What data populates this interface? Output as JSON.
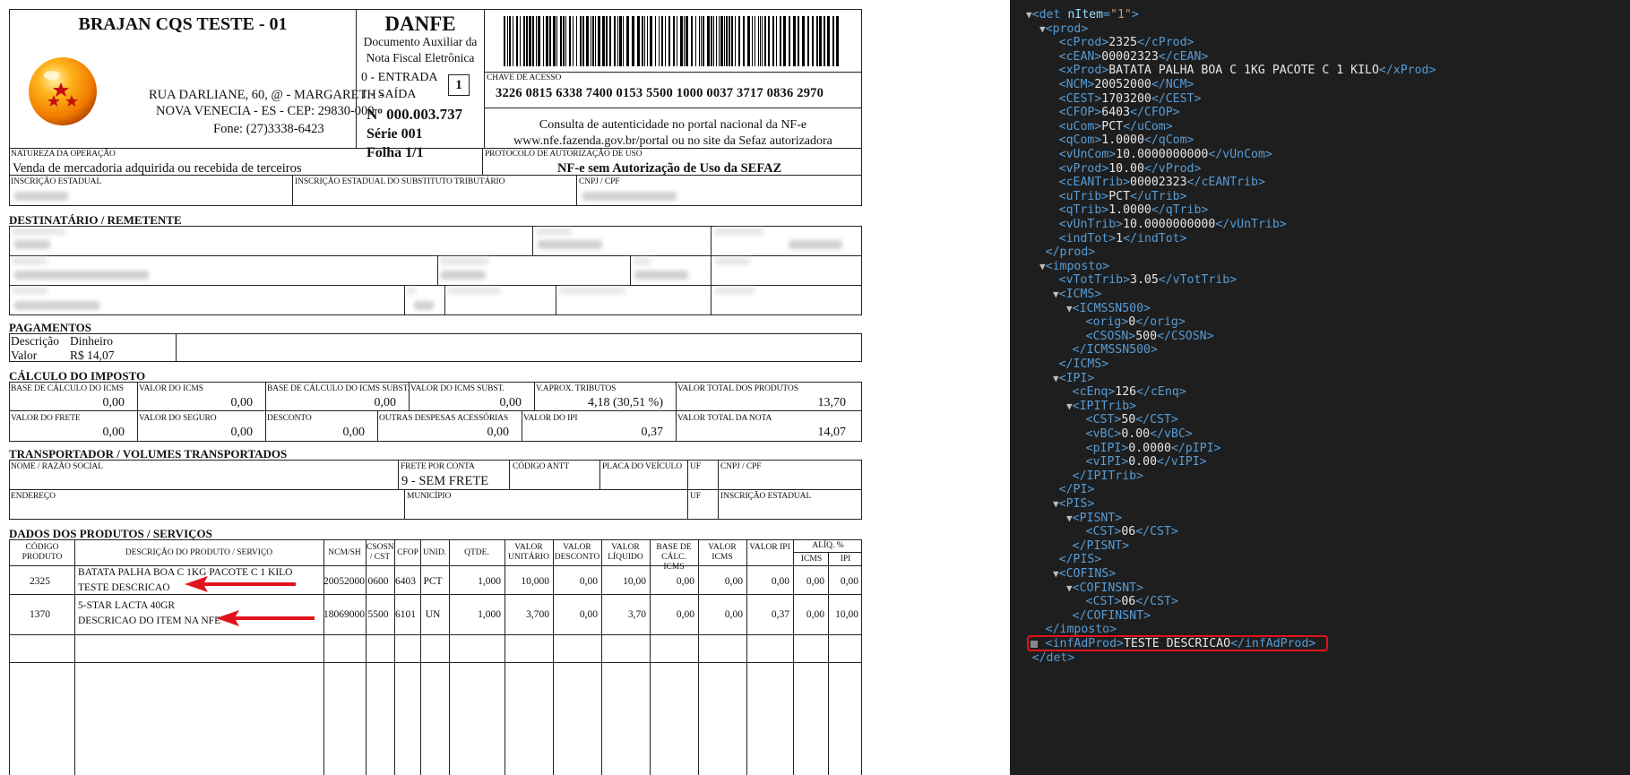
{
  "emitente": {
    "nome": "BRAJAN CQS TESTE - 01",
    "endereco1": "RUA DARLIANE, 60, @ - MARGARETH -",
    "endereco2": "NOVA VENECIA - ES - CEP: 29830-000",
    "fone": "Fone: (27)3338-6423",
    "logo": "dragon-ball-logo"
  },
  "danfe": {
    "title": "DANFE",
    "sub1": "Documento Auxiliar da",
    "sub2": "Nota Fiscal Eletrônica",
    "entrada": "0 - ENTRADA",
    "saida": "1 - SAÍDA",
    "tipo": "1",
    "numero": "Nº 000.003.737",
    "serie": "Série 001",
    "folha": "Folha 1/1"
  },
  "chave": {
    "label": "CHAVE DE ACESSO",
    "value": "3226 0815 6338 7400 0153 5500 1000 0037 3717 0836 2970",
    "consulta1": "Consulta de autenticidade no portal nacional da NF-e",
    "consulta2": "www.nfe.fazenda.gov.br/portal ou no site da Sefaz autorizadora"
  },
  "natureza": {
    "label": "NATUREZA DA OPERAÇÃO",
    "value": "Venda de mercadoria adquirida ou recebida de terceiros",
    "protocolo_label": "PROTOCOLO DE AUTORIZAÇÃO DE USO",
    "protocolo_value": "NF-e sem Autorização de Uso da SEFAZ"
  },
  "inscricao": {
    "ie_label": "INSCRIÇÃO ESTADUAL",
    "ie_st_label": "INSCRIÇÃO ESTADUAL DO SUBSTITUTO TRIBUTÁRIO",
    "cnpj_label": "CNPJ / CPF"
  },
  "destinatario": {
    "title": "DESTINATÁRIO / REMETENTE"
  },
  "pagamentos": {
    "title": "PAGAMENTOS",
    "descricao_label": "Descrição",
    "descricao_value": "Dinheiro",
    "valor_label": "Valor",
    "valor_value": "R$ 14,07"
  },
  "calculo": {
    "title": "CÁLCULO DO IMPOSTO",
    "row1": [
      {
        "label": "BASE DE CÁLCULO DO ICMS",
        "value": "0,00"
      },
      {
        "label": "VALOR DO ICMS",
        "value": "0,00"
      },
      {
        "label": "BASE DE CÁLCULO DO ICMS SUBST.",
        "value": "0,00"
      },
      {
        "label": "VALOR DO ICMS SUBST.",
        "value": "0,00"
      },
      {
        "label": "V.APROX. TRIBUTOS",
        "value": "4,18 (30,51 %)"
      },
      {
        "label": "VALOR TOTAL DOS PRODUTOS",
        "value": "13,70"
      }
    ],
    "row2": [
      {
        "label": "VALOR DO FRETE",
        "value": "0,00"
      },
      {
        "label": "VALOR DO SEGURO",
        "value": "0,00"
      },
      {
        "label": "DESCONTO",
        "value": "0,00"
      },
      {
        "label": "OUTRAS DESPESAS ACESSÓRIAS",
        "value": "0,00"
      },
      {
        "label": "VALOR DO IPI",
        "value": "0,37"
      },
      {
        "label": "VALOR TOTAL DA NOTA",
        "value": "14,07"
      }
    ]
  },
  "transportador": {
    "title": "TRANSPORTADOR / VOLUMES TRANSPORTADOS",
    "nome_label": "NOME / RAZÃO SOCIAL",
    "frete_label": "FRETE POR CONTA",
    "frete_value": "9 - SEM FRETE",
    "antt_label": "CÓDIGO ANTT",
    "placa_label": "PLACA DO VEÍCULO",
    "uf_label": "UF",
    "cnpj_label": "CNPJ / CPF",
    "endereco_label": "ENDEREÇO",
    "municipio_label": "MUNICÍPIO",
    "uf2_label": "UF",
    "ie_label": "INSCRIÇÃO ESTADUAL"
  },
  "produtos": {
    "title": "DADOS DOS PRODUTOS / SERVIÇOS",
    "headers": {
      "codigo": "CÓDIGO PRODUTO",
      "descricao": "DESCRIÇÃO DO PRODUTO / SERVIÇO",
      "ncm": "NCM/SH",
      "csosn": "CSOSN / CST",
      "cfop": "CFOP",
      "unid": "UNID.",
      "qtde": "QTDE.",
      "vunit": "VALOR UNITÁRIO",
      "vdesc": "VALOR DESCONTO",
      "vliq": "VALOR LÍQUIDO",
      "bcicms": "BASE DE CÁLC. ICMS",
      "vicms": "VALOR ICMS",
      "vipi": "VALOR IPI",
      "aliq": "ALÍQ. %",
      "aicms": "ICMS",
      "aipi": "IPI"
    },
    "rows": [
      {
        "codigo": "2325",
        "desc1": "BATATA PALHA BOA C 1KG PACOTE C 1 KILO",
        "desc2": "TESTE DESCRICAO",
        "ncm": "20052000",
        "csosn": "0600",
        "cfop": "6403",
        "unid": "PCT",
        "qtde": "1,000",
        "vunit": "10,000",
        "vdesc": "0,00",
        "vliq": "10,00",
        "bcicms": "0,00",
        "vicms": "0,00",
        "vipi": "0,00",
        "aicms": "0,00",
        "aipi": "0,00"
      },
      {
        "codigo": "1370",
        "desc1": "5-STAR LACTA 40GR",
        "desc2": "DESCRICAO DO ITEM NA NFE",
        "ncm": "18069000",
        "csosn": "5500",
        "cfop": "6101",
        "unid": "UN",
        "qtde": "1,000",
        "vunit": "3,700",
        "vdesc": "0,00",
        "vliq": "3,70",
        "bcicms": "0,00",
        "vicms": "0,00",
        "vipi": "0,37",
        "aicms": "0,00",
        "aipi": "10,00"
      }
    ]
  },
  "xml": {
    "lines": [
      {
        "indent": 0,
        "tri": true,
        "open": "det",
        "attr": "nItem",
        "attrval": "\"1\"",
        "kind": "open"
      },
      {
        "indent": 1,
        "tri": true,
        "open": "prod",
        "kind": "open"
      },
      {
        "indent": 2,
        "tag": "cProd",
        "text": "2325",
        "kind": "leaf"
      },
      {
        "indent": 2,
        "tag": "cEAN",
        "text": "00002323",
        "kind": "leaf"
      },
      {
        "indent": 2,
        "tag": "xProd",
        "text": "BATATA PALHA BOA C 1KG PACOTE C 1 KILO",
        "kind": "leaf"
      },
      {
        "indent": 2,
        "tag": "NCM",
        "text": "20052000",
        "kind": "leaf"
      },
      {
        "indent": 2,
        "tag": "CEST",
        "text": "1703200",
        "kind": "leaf"
      },
      {
        "indent": 2,
        "tag": "CFOP",
        "text": "6403",
        "kind": "leaf"
      },
      {
        "indent": 2,
        "tag": "uCom",
        "text": "PCT",
        "kind": "leaf"
      },
      {
        "indent": 2,
        "tag": "qCom",
        "text": "1.0000",
        "kind": "leaf"
      },
      {
        "indent": 2,
        "tag": "vUnCom",
        "text": "10.0000000000",
        "kind": "leaf"
      },
      {
        "indent": 2,
        "tag": "vProd",
        "text": "10.00",
        "kind": "leaf"
      },
      {
        "indent": 2,
        "tag": "cEANTrib",
        "text": "00002323",
        "kind": "leaf"
      },
      {
        "indent": 2,
        "tag": "uTrib",
        "text": "PCT",
        "kind": "leaf"
      },
      {
        "indent": 2,
        "tag": "qTrib",
        "text": "1.0000",
        "kind": "leaf"
      },
      {
        "indent": 2,
        "tag": "vUnTrib",
        "text": "10.0000000000",
        "kind": "leaf"
      },
      {
        "indent": 2,
        "tag": "indTot",
        "text": "1",
        "kind": "leaf"
      },
      {
        "indent": 1,
        "close": "prod",
        "kind": "close"
      },
      {
        "indent": 1,
        "tri": true,
        "open": "imposto",
        "kind": "open"
      },
      {
        "indent": 2,
        "tag": "vTotTrib",
        "text": "3.05",
        "kind": "leaf"
      },
      {
        "indent": 2,
        "tri": true,
        "open": "ICMS",
        "kind": "open"
      },
      {
        "indent": 3,
        "tri": true,
        "open": "ICMSSN500",
        "kind": "open"
      },
      {
        "indent": 4,
        "tag": "orig",
        "text": "0",
        "kind": "leaf"
      },
      {
        "indent": 4,
        "tag": "CSOSN",
        "text": "500",
        "kind": "leaf"
      },
      {
        "indent": 3,
        "close": "ICMSSN500",
        "kind": "close"
      },
      {
        "indent": 2,
        "close": "ICMS",
        "kind": "close"
      },
      {
        "indent": 2,
        "tri": true,
        "open": "IPI",
        "kind": "open"
      },
      {
        "indent": 3,
        "tag": "cEnq",
        "text": "126",
        "kind": "leaf"
      },
      {
        "indent": 3,
        "tri": true,
        "open": "IPITrib",
        "kind": "open"
      },
      {
        "indent": 4,
        "tag": "CST",
        "text": "50",
        "kind": "leaf"
      },
      {
        "indent": 4,
        "tag": "vBC",
        "text": "0.00",
        "kind": "leaf"
      },
      {
        "indent": 4,
        "tag": "pIPI",
        "text": "0.0000",
        "kind": "leaf"
      },
      {
        "indent": 4,
        "tag": "vIPI",
        "text": "0.00",
        "kind": "leaf"
      },
      {
        "indent": 3,
        "close": "IPITrib",
        "kind": "close"
      },
      {
        "indent": 2,
        "close": "PI",
        "kind": "close"
      },
      {
        "indent": 2,
        "tri": true,
        "open": "PIS",
        "kind": "open"
      },
      {
        "indent": 3,
        "tri": true,
        "open": "PISNT",
        "kind": "open"
      },
      {
        "indent": 4,
        "tag": "CST",
        "text": "06",
        "kind": "leaf"
      },
      {
        "indent": 3,
        "close": "PISNT",
        "kind": "close"
      },
      {
        "indent": 2,
        "close": "PIS",
        "kind": "close"
      },
      {
        "indent": 2,
        "tri": true,
        "open": "COFINS",
        "kind": "open"
      },
      {
        "indent": 3,
        "tri": true,
        "open": "COFINSNT",
        "kind": "open"
      },
      {
        "indent": 4,
        "tag": "CST",
        "text": "06",
        "kind": "leaf"
      },
      {
        "indent": 3,
        "close": "COFINSNT",
        "kind": "close"
      },
      {
        "indent": 1,
        "close": "imposto",
        "kind": "close"
      },
      {
        "indent": 1,
        "tag": "infAdProd",
        "text": "TESTE DESCRICAO",
        "kind": "leaf",
        "highlight": true
      },
      {
        "indent": 0,
        "close": "det",
        "kind": "close"
      }
    ],
    "highlight_color": "#e0141e",
    "arrow_color": "#e0141e"
  }
}
